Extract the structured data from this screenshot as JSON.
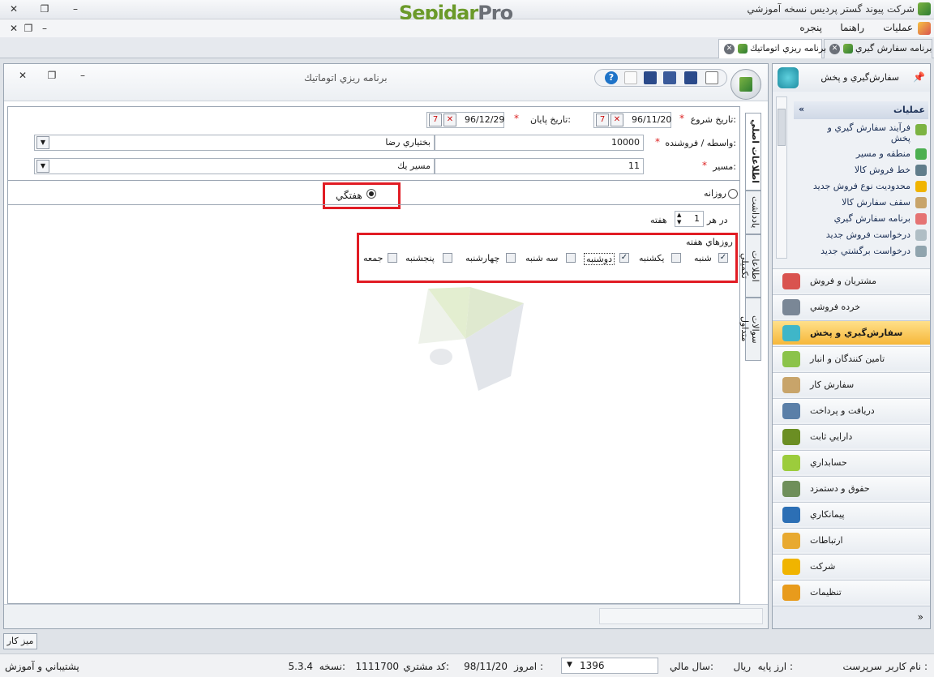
{
  "app": {
    "title": "شرکت پيوند گستر پرديس نسخه آموزشي",
    "logo_part1": "Sepidar",
    "logo_part2": "Pro"
  },
  "menu": [
    "عمليات",
    "راهنما",
    "پنجره"
  ],
  "tabs": [
    {
      "label": "برنامه سفارش گيري"
    },
    {
      "label": "برنامه ريزي اتوماتيك"
    }
  ],
  "doc": {
    "title": "برنامه ريزي اتوماتيك"
  },
  "form": {
    "start_date_label": "تاريخ شروع:",
    "start_date": "96/11/20",
    "end_date_label": "تاريخ پايان:",
    "end_date": "96/12/29",
    "agent_label": "واسطه / فروشنده:",
    "agent_code": "10000",
    "agent_name": "بختياري رضا",
    "route_label": "مسير:",
    "route_code": "11",
    "route_name": "مسير يك",
    "daily_label": "روزانه",
    "weekly_label": "هفتگي",
    "every_label": "در هر",
    "every_value": "1",
    "week_label": "هفته",
    "weekdays_label": "روزهاي هفته",
    "weekdays": [
      {
        "label": "شنبه",
        "checked": true
      },
      {
        "label": "يكشنبه",
        "checked": false
      },
      {
        "label": "دوشنبه",
        "checked": true
      },
      {
        "label": "سه شنبه",
        "checked": false
      },
      {
        "label": "چهارشنبه",
        "checked": false
      },
      {
        "label": "پنجشنبه",
        "checked": false
      },
      {
        "label": "جمعه",
        "checked": false
      }
    ]
  },
  "vtabs": [
    "اطلاعات اصلي",
    "يادداشت",
    "اطلاعات تكميلي",
    "سوالات متداول"
  ],
  "sidebar": {
    "header": "سفارش‌گيري و پخش",
    "ops_title": "عمليات",
    "ops": [
      "فرآيند سفارش گيري و پخش",
      "منطقه و مسير",
      "خط فروش كالا",
      "محدوديت نوع فروش جديد",
      "سقف سفارش كالا",
      "برنامه سفارش گيري",
      "درخواست فروش جديد",
      "درخواست برگشتي جديد"
    ],
    "modules": [
      {
        "label": "مشتريان و فروش",
        "color": "#d9534f"
      },
      {
        "label": "خرده فروشي",
        "color": "#7a8796"
      },
      {
        "label": "سفارش‌گيري و پخش",
        "color": "#3fb6c8",
        "active": true
      },
      {
        "label": "تامين كنندگان و انبار",
        "color": "#8bc34a"
      },
      {
        "label": "سفارش كار",
        "color": "#c8a46a"
      },
      {
        "label": "دريافت و پرداخت",
        "color": "#5a7fa8"
      },
      {
        "label": "دارايي ثابت",
        "color": "#6b8e23"
      },
      {
        "label": "حسابداري",
        "color": "#9ccc3c"
      },
      {
        "label": "حقوق و دستمزد",
        "color": "#6f8f5a"
      },
      {
        "label": "پيمانكاري",
        "color": "#2c6fb5"
      },
      {
        "label": "ارتباطات",
        "color": "#e8a930"
      },
      {
        "label": "شركت",
        "color": "#f0b400"
      },
      {
        "label": "تنظيمات",
        "color": "#e89b1c"
      }
    ]
  },
  "desktop_button": "ميز كار",
  "status": {
    "user_label": "نام كاربر :",
    "user": "سرپرست",
    "currency_label": "ارز پايه :",
    "currency": "ريال",
    "fiscal_label": "سال مالي:",
    "fiscal_year": "1396",
    "today_label": "امروز :",
    "today": "98/11/20",
    "customer_label": "كد مشتري:",
    "customer_code": "1111700",
    "version_label": "نسخه:",
    "version": "5.3.4",
    "support": "پشتيباني و آموزش"
  }
}
